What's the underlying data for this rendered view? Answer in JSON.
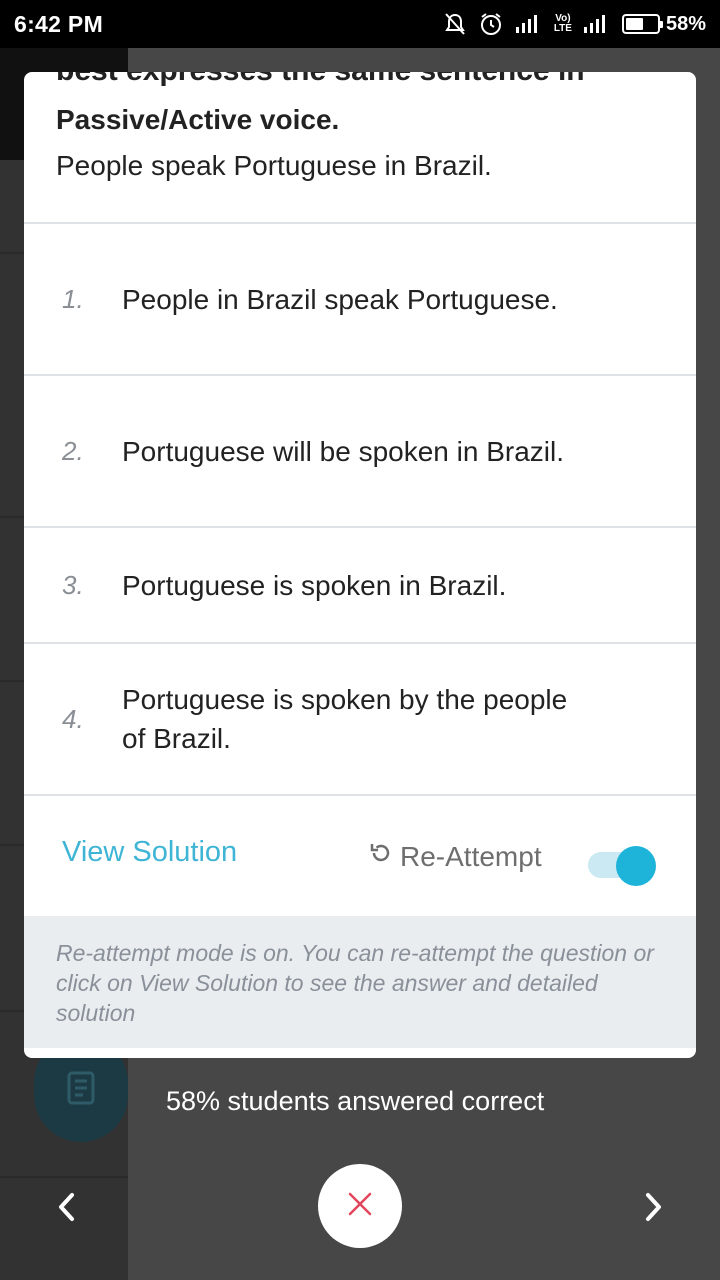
{
  "status_bar": {
    "time": "6:42 PM",
    "battery": "58%",
    "volte": "Vo)",
    "lte": "LTE",
    "icons": [
      "alarm-off-icon",
      "alarm-clock-icon",
      "signal-icon",
      "volte-icon",
      "signal-icon",
      "battery-icon"
    ]
  },
  "question": {
    "clipped_line": "best expresses the same sentence in",
    "instruction": "Passive/Active voice.",
    "sentence": "People speak Portuguese in Brazil."
  },
  "options": [
    {
      "number": "1.",
      "text": "People in Brazil speak Portuguese."
    },
    {
      "number": "2.",
      "text": "Portuguese will be spoken in Brazil."
    },
    {
      "number": "3.",
      "text": "Portuguese is spoken in Brazil."
    },
    {
      "number": "4.",
      "text": "Portuguese is spoken by the people of Brazil."
    }
  ],
  "actions": {
    "view_solution": "View Solution",
    "reattempt": "Re-Attempt",
    "reattempt_enabled": true
  },
  "note": "Re-attempt mode is on. You can re-attempt the question or click on View Solution to see the answer and detailed solution",
  "footer": {
    "stats": "58% students answered correct"
  },
  "colors": {
    "accent": "#1eb3d8",
    "link": "#3fb5d6",
    "close_x": "#e0475a",
    "overlay": "#474747"
  }
}
